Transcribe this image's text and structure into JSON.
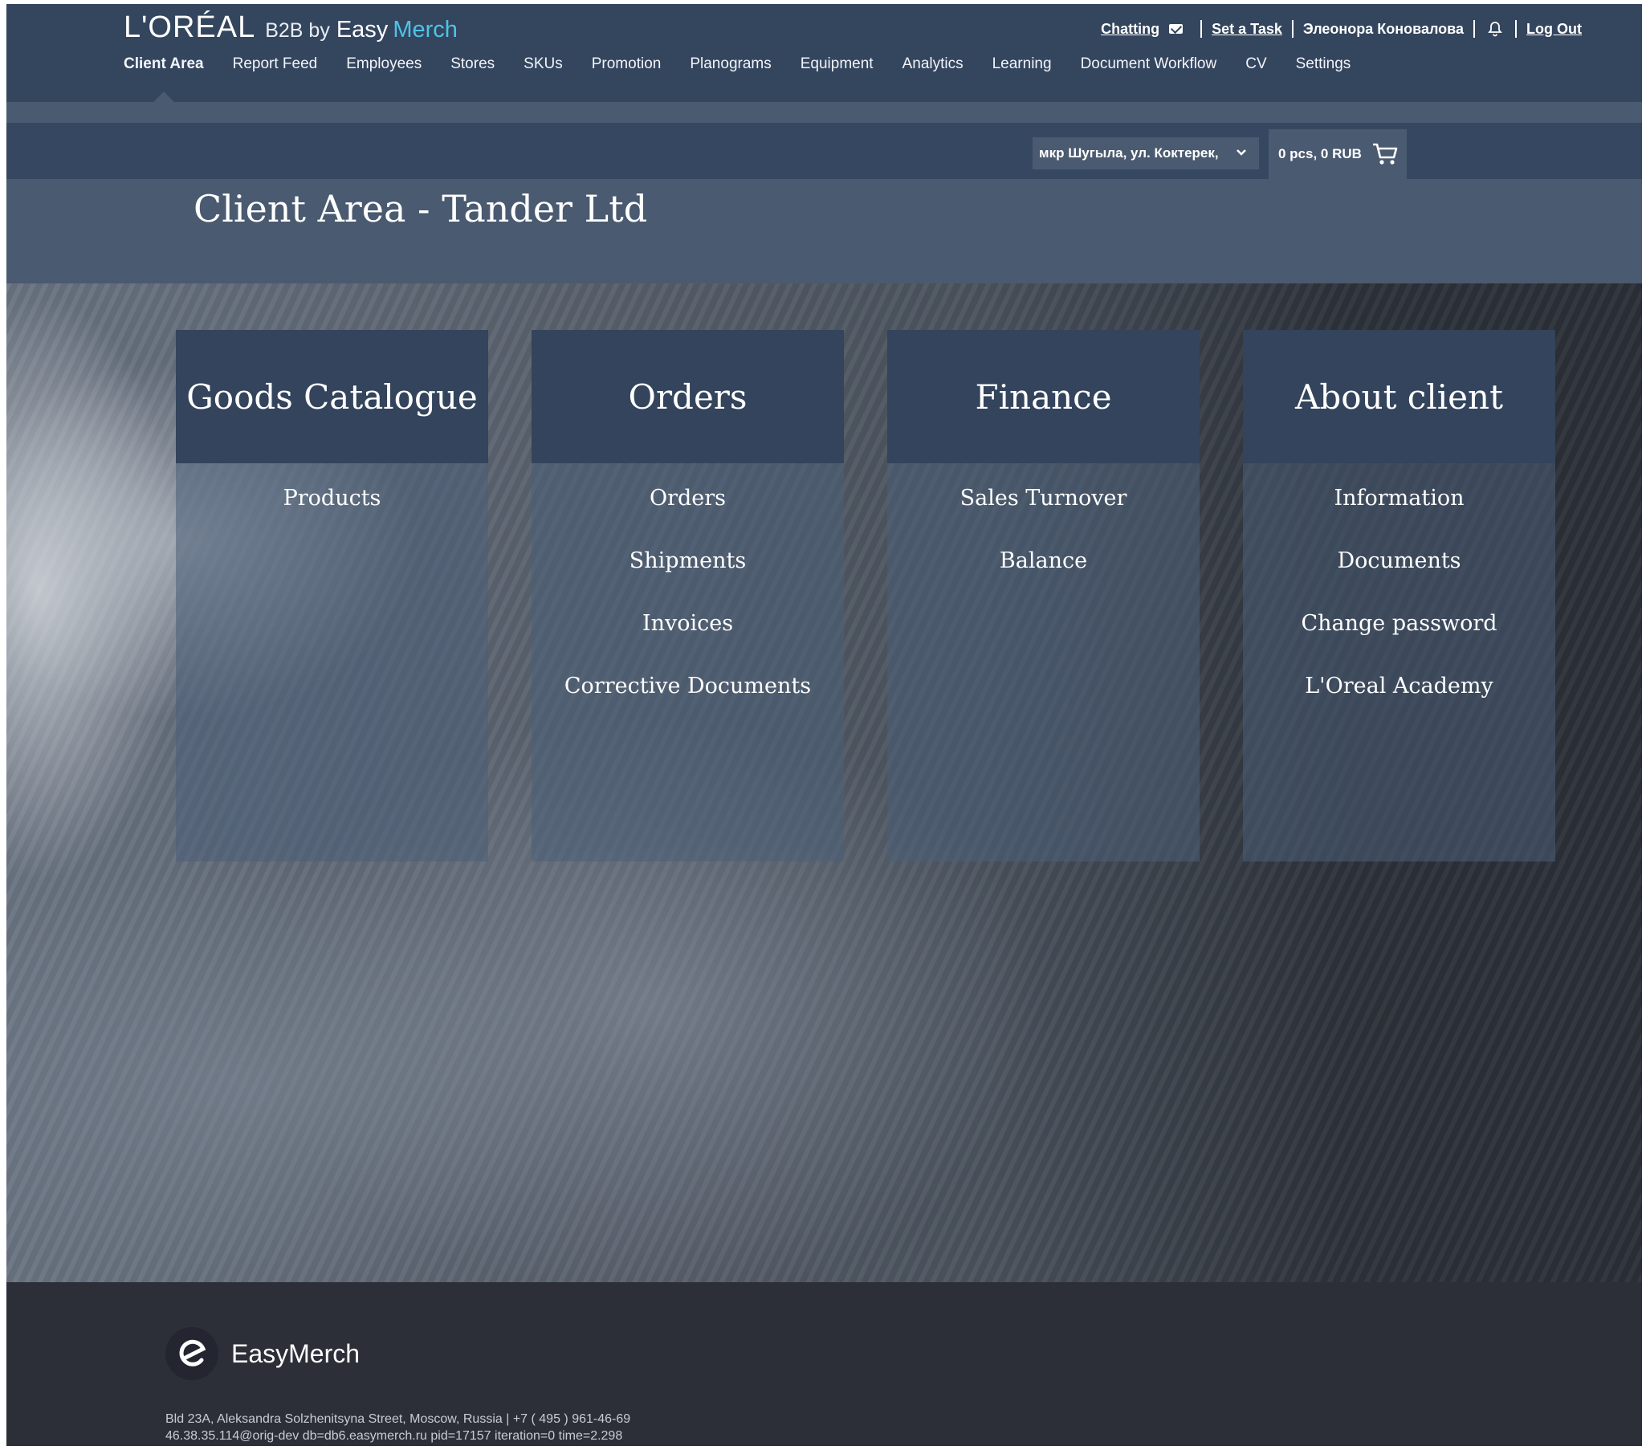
{
  "header": {
    "brand": "L'ORÉAL",
    "b2b_label": "B2B by",
    "easy_label": "Easy",
    "merch_label": "Merch",
    "links": {
      "chatting": "Chatting",
      "set_task": "Set a Task",
      "user_name": "Элеонора Коновалова",
      "logout": "Log Out"
    },
    "nav": [
      "Client Area",
      "Report Feed",
      "Employees",
      "Stores",
      "SKUs",
      "Promotion",
      "Planograms",
      "Equipment",
      "Analytics",
      "Learning",
      "Document Workflow",
      "CV",
      "Settings"
    ],
    "active_nav": "Client Area"
  },
  "toolbar": {
    "store_selected": "мкр Шугыла, ул. Коктерек,",
    "cart_summary": "0 pcs, 0 RUB"
  },
  "page": {
    "title": "Client Area - Tander Ltd"
  },
  "cards": [
    {
      "title": "Goods Catalogue",
      "links": [
        "Products"
      ]
    },
    {
      "title": "Orders",
      "links": [
        "Orders",
        "Shipments",
        "Invoices",
        "Corrective Documents"
      ]
    },
    {
      "title": "Finance",
      "links": [
        "Sales Turnover",
        "Balance"
      ]
    },
    {
      "title": "About client",
      "links": [
        "Information",
        "Documents",
        "Change password",
        "L'Oreal Academy"
      ]
    }
  ],
  "footer": {
    "brand": "EasyMerch",
    "address": "Bld 23A, Aleksandra Solzhenitsyna Street, Moscow, Russia | +7 ( 495 ) 961-46-69",
    "debug": "46.38.35.114@orig-dev db=db6.easymerch.ru pid=17157 iteration=0 time=2.298"
  },
  "colors": {
    "header_bg": "#34455e",
    "accent": "#4fc3e6",
    "card_head": "#33445c",
    "footer_bg": "#2c2f38"
  }
}
